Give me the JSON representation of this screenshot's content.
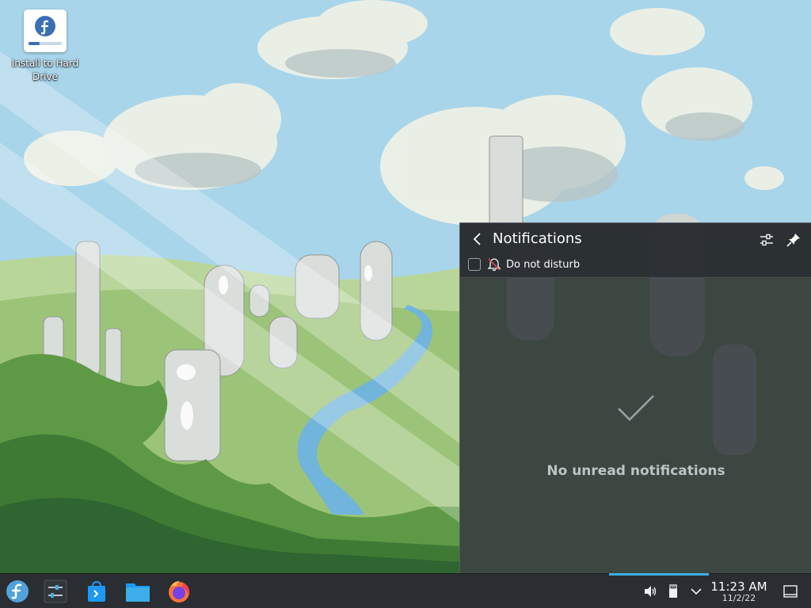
{
  "desktop": {
    "icons": [
      {
        "label": "Install to Hard Drive",
        "icon": "fedora-installer-icon"
      }
    ]
  },
  "notifications_panel": {
    "title": "Notifications",
    "back_icon": "chevron-left-icon",
    "configure_icon": "configure-icon",
    "pin_icon": "pin-icon",
    "do_not_disturb": {
      "label": "Do not disturb",
      "checked": false,
      "icon": "bell-off-icon"
    },
    "empty_icon": "checkmark-icon",
    "empty_message": "No unread notifications"
  },
  "taskbar": {
    "launchers": [
      {
        "name": "application-launcher",
        "icon": "fedora-logo-icon"
      },
      {
        "name": "system-settings",
        "icon": "sliders-icon"
      },
      {
        "name": "discover",
        "icon": "store-bag-icon"
      },
      {
        "name": "dolphin",
        "icon": "folder-icon"
      },
      {
        "name": "firefox",
        "icon": "firefox-icon"
      }
    ],
    "tray": [
      {
        "name": "volume",
        "icon": "speaker-icon"
      },
      {
        "name": "removable-devices",
        "icon": "usb-drive-icon"
      },
      {
        "name": "show-hidden",
        "icon": "chevron-down-icon"
      }
    ],
    "clock": {
      "time": "11:23 AM",
      "date": "11/2/22"
    },
    "show_desktop_icon": "show-desktop-icon",
    "accent": "#3daee9"
  }
}
